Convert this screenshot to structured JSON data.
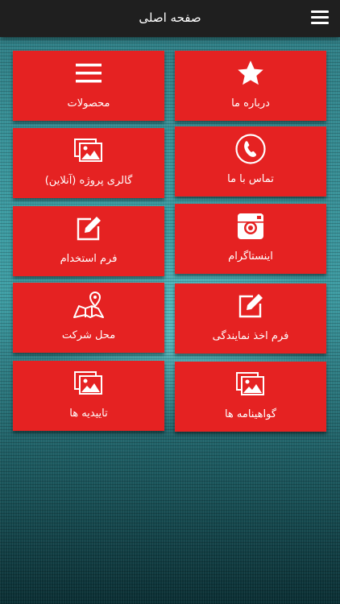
{
  "header": {
    "title": "صفحه اصلی",
    "menu_icon": "hamburger-menu-icon"
  },
  "tiles": [
    {
      "label": "درباره ما",
      "icon": "star-icon"
    },
    {
      "label": "محصولات",
      "icon": "list-icon"
    },
    {
      "label": "تماس با ما",
      "icon": "phone-icon"
    },
    {
      "label": "گالری پروژه (آنلاین)",
      "icon": "gallery-icon"
    },
    {
      "label": "اینستاگرام",
      "icon": "instagram-icon"
    },
    {
      "label": "فرم استخدام",
      "icon": "edit-icon"
    },
    {
      "label": "فرم اخذ نمایندگی",
      "icon": "edit-icon"
    },
    {
      "label": "محل شرکت",
      "icon": "map-icon"
    },
    {
      "label": "گواهینامه ها",
      "icon": "gallery-icon"
    },
    {
      "label": "تاییدیه ها",
      "icon": "gallery-icon"
    }
  ],
  "colors": {
    "tile": "#e52222",
    "topbar": "#1f1f1f",
    "text": "#ffffff"
  }
}
